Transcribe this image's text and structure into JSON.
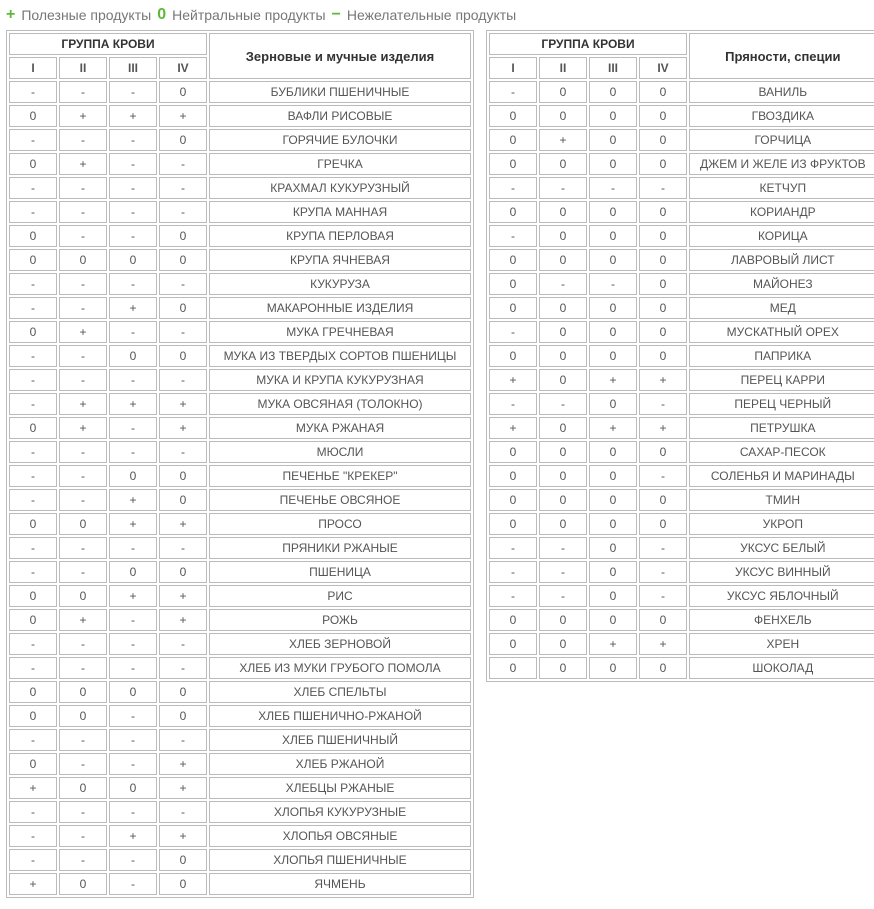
{
  "legend": {
    "plus_label": "Полезные продукты",
    "zero_label": "Нейтральные продукты",
    "minus_label": "Нежелательные продукты"
  },
  "group_header": "ГРУППА КРОВИ",
  "columns": [
    "I",
    "II",
    "III",
    "IV"
  ],
  "tables": [
    {
      "category": "Зерновые и мучные изделия",
      "rows": [
        {
          "v": [
            "-",
            "-",
            "-",
            "0"
          ],
          "name": "БУБЛИКИ ПШЕНИЧНЫЕ"
        },
        {
          "v": [
            "0",
            "+",
            "+",
            "+"
          ],
          "name": "ВАФЛИ РИСОВЫЕ"
        },
        {
          "v": [
            "-",
            "-",
            "-",
            "0"
          ],
          "name": "ГОРЯЧИЕ БУЛОЧКИ"
        },
        {
          "v": [
            "0",
            "+",
            "-",
            "-"
          ],
          "name": "ГРЕЧКА"
        },
        {
          "v": [
            "-",
            "-",
            "-",
            "-"
          ],
          "name": "КРАХМАЛ КУКУРУЗНЫЙ"
        },
        {
          "v": [
            "-",
            "-",
            "-",
            "-"
          ],
          "name": "КРУПА МАННАЯ"
        },
        {
          "v": [
            "0",
            "-",
            "-",
            "0"
          ],
          "name": "КРУПА ПЕРЛОВАЯ"
        },
        {
          "v": [
            "0",
            "0",
            "0",
            "0"
          ],
          "name": "КРУПА ЯЧНЕВАЯ"
        },
        {
          "v": [
            "-",
            "-",
            "-",
            "-"
          ],
          "name": "КУКУРУЗА"
        },
        {
          "v": [
            "-",
            "-",
            "+",
            "0"
          ],
          "name": "МАКАРОННЫЕ ИЗДЕЛИЯ"
        },
        {
          "v": [
            "0",
            "+",
            "-",
            "-"
          ],
          "name": "МУКА ГРЕЧНЕВАЯ"
        },
        {
          "v": [
            "-",
            "-",
            "0",
            "0"
          ],
          "name": "МУКА ИЗ ТВЕРДЫХ СОРТОВ ПШЕНИЦЫ"
        },
        {
          "v": [
            "-",
            "-",
            "-",
            "-"
          ],
          "name": "МУКА И КРУПА КУКУРУЗНАЯ"
        },
        {
          "v": [
            "-",
            "+",
            "+",
            "+"
          ],
          "name": "МУКА ОВСЯНАЯ (ТОЛОКНО)"
        },
        {
          "v": [
            "0",
            "+",
            "-",
            "+"
          ],
          "name": "МУКА РЖАНАЯ"
        },
        {
          "v": [
            "-",
            "-",
            "-",
            "-"
          ],
          "name": "МЮСЛИ"
        },
        {
          "v": [
            "-",
            "-",
            "0",
            "0"
          ],
          "name": "ПЕЧЕНЬЕ \"КРЕКЕР\""
        },
        {
          "v": [
            "-",
            "-",
            "+",
            "0"
          ],
          "name": "ПЕЧЕНЬЕ ОВСЯНОЕ"
        },
        {
          "v": [
            "0",
            "0",
            "+",
            "+"
          ],
          "name": "ПРОСО"
        },
        {
          "v": [
            "-",
            "-",
            "-",
            "-"
          ],
          "name": "ПРЯНИКИ РЖАНЫЕ"
        },
        {
          "v": [
            "-",
            "-",
            "0",
            "0"
          ],
          "name": "ПШЕНИЦА"
        },
        {
          "v": [
            "0",
            "0",
            "+",
            "+"
          ],
          "name": "РИС"
        },
        {
          "v": [
            "0",
            "+",
            "-",
            "+"
          ],
          "name": "РОЖЬ"
        },
        {
          "v": [
            "-",
            "-",
            "-",
            "-"
          ],
          "name": "ХЛЕБ ЗЕРНОВОЙ"
        },
        {
          "v": [
            "-",
            "-",
            "-",
            "-"
          ],
          "name": "ХЛЕБ ИЗ МУКИ ГРУБОГО ПОМОЛА"
        },
        {
          "v": [
            "0",
            "0",
            "0",
            "0"
          ],
          "name": "ХЛЕБ СПЕЛЬТЫ"
        },
        {
          "v": [
            "0",
            "0",
            "-",
            "0"
          ],
          "name": "ХЛЕБ ПШЕНИЧНО-РЖАНОЙ"
        },
        {
          "v": [
            "-",
            "-",
            "-",
            "-"
          ],
          "name": "ХЛЕБ ПШЕНИЧНЫЙ"
        },
        {
          "v": [
            "0",
            "-",
            "-",
            "+"
          ],
          "name": "ХЛЕБ РЖАНОЙ"
        },
        {
          "v": [
            "+",
            "0",
            "0",
            "+"
          ],
          "name": "ХЛЕБЦЫ РЖАНЫЕ"
        },
        {
          "v": [
            "-",
            "-",
            "-",
            "-"
          ],
          "name": "ХЛОПЬЯ КУКУРУЗНЫЕ"
        },
        {
          "v": [
            "-",
            "-",
            "+",
            "+"
          ],
          "name": "ХЛОПЬЯ ОВСЯНЫЕ"
        },
        {
          "v": [
            "-",
            "-",
            "-",
            "0"
          ],
          "name": "ХЛОПЬЯ ПШЕНИЧНЫЕ"
        },
        {
          "v": [
            "+",
            "0",
            "-",
            "0"
          ],
          "name": "ЯЧМЕНЬ"
        }
      ]
    },
    {
      "category": "Пряности, специи",
      "rows": [
        {
          "v": [
            "-",
            "0",
            "0",
            "0"
          ],
          "name": "ВАНИЛЬ"
        },
        {
          "v": [
            "0",
            "0",
            "0",
            "0"
          ],
          "name": "ГВОЗДИКА"
        },
        {
          "v": [
            "0",
            "+",
            "0",
            "0"
          ],
          "name": "ГОРЧИЦА"
        },
        {
          "v": [
            "0",
            "0",
            "0",
            "0"
          ],
          "name": "ДЖЕМ И ЖЕЛЕ ИЗ ФРУКТОВ"
        },
        {
          "v": [
            "-",
            "-",
            "-",
            "-"
          ],
          "name": "КЕТЧУП"
        },
        {
          "v": [
            "0",
            "0",
            "0",
            "0"
          ],
          "name": "КОРИАНДР"
        },
        {
          "v": [
            "-",
            "0",
            "0",
            "0"
          ],
          "name": "КОРИЦА"
        },
        {
          "v": [
            "0",
            "0",
            "0",
            "0"
          ],
          "name": "ЛАВРОВЫЙ ЛИСТ"
        },
        {
          "v": [
            "0",
            "-",
            "-",
            "0"
          ],
          "name": "МАЙОНЕЗ"
        },
        {
          "v": [
            "0",
            "0",
            "0",
            "0"
          ],
          "name": "МЕД"
        },
        {
          "v": [
            "-",
            "0",
            "0",
            "0"
          ],
          "name": "МУСКАТНЫЙ ОРЕХ"
        },
        {
          "v": [
            "0",
            "0",
            "0",
            "0"
          ],
          "name": "ПАПРИКА"
        },
        {
          "v": [
            "+",
            "0",
            "+",
            "+"
          ],
          "name": "ПЕРЕЦ КАРРИ"
        },
        {
          "v": [
            "-",
            "-",
            "0",
            "-"
          ],
          "name": "ПЕРЕЦ ЧЕРНЫЙ"
        },
        {
          "v": [
            "+",
            "0",
            "+",
            "+"
          ],
          "name": "ПЕТРУШКА"
        },
        {
          "v": [
            "0",
            "0",
            "0",
            "0"
          ],
          "name": "САХАР-ПЕСОК"
        },
        {
          "v": [
            "0",
            "0",
            "0",
            "-"
          ],
          "name": "СОЛЕНЬЯ И МАРИНАДЫ"
        },
        {
          "v": [
            "0",
            "0",
            "0",
            "0"
          ],
          "name": "ТМИН"
        },
        {
          "v": [
            "0",
            "0",
            "0",
            "0"
          ],
          "name": "УКРОП"
        },
        {
          "v": [
            "-",
            "-",
            "0",
            "-"
          ],
          "name": "УКСУС БЕЛЫЙ"
        },
        {
          "v": [
            "-",
            "-",
            "0",
            "-"
          ],
          "name": "УКСУС ВИННЫЙ"
        },
        {
          "v": [
            "-",
            "-",
            "0",
            "-"
          ],
          "name": "УКСУС ЯБЛОЧНЫЙ"
        },
        {
          "v": [
            "0",
            "0",
            "0",
            "0"
          ],
          "name": "ФЕНХЕЛЬ"
        },
        {
          "v": [
            "0",
            "0",
            "+",
            "+"
          ],
          "name": "ХРЕН"
        },
        {
          "v": [
            "0",
            "0",
            "0",
            "0"
          ],
          "name": "ШОКОЛАД"
        }
      ]
    }
  ]
}
